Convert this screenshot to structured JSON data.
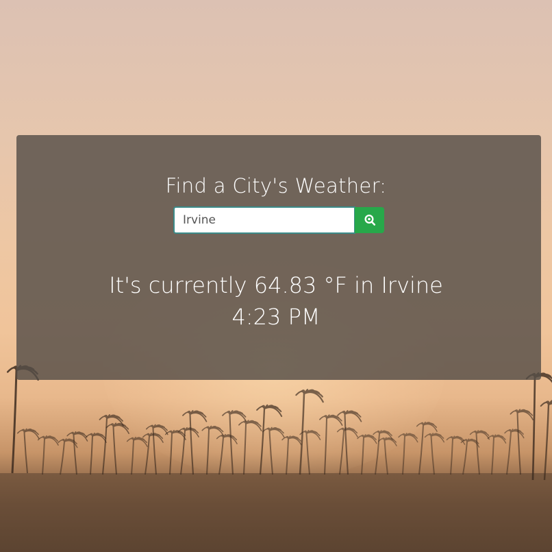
{
  "page": {
    "heading": "Find a City's Weather:"
  },
  "search": {
    "value": "Irvine",
    "button_icon": "search-icon"
  },
  "result": {
    "prefix": "It's currently ",
    "temperature": "64.83",
    "unit": "°F",
    "connector": " in ",
    "city": "Irvine",
    "time": "4:23 PM"
  },
  "colors": {
    "panel": "#554e48",
    "button": "#27a84a",
    "input_border": "#3b8c8a",
    "text": "#ffffff"
  }
}
